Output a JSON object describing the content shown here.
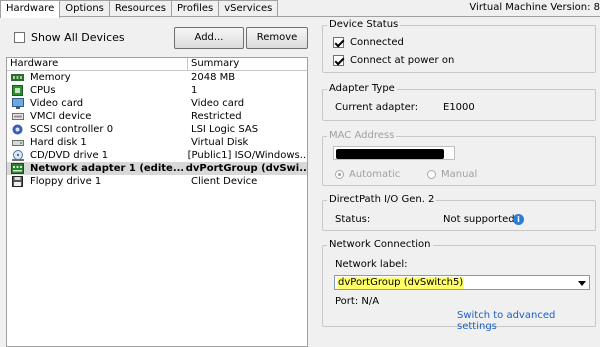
{
  "tabs": [
    {
      "label": "Hardware",
      "active": true
    },
    {
      "label": "Options",
      "active": false
    },
    {
      "label": "Resources",
      "active": false
    },
    {
      "label": "Profiles",
      "active": false
    },
    {
      "label": "vServices",
      "active": false
    }
  ],
  "vm_version": "Virtual Machine Version: 8",
  "toolbar": {
    "show_all_label": "Show All Devices",
    "show_all_checked": false,
    "add_label": "Add...",
    "remove_label": "Remove"
  },
  "table": {
    "headers": [
      "Hardware",
      "Summary"
    ],
    "rows": [
      {
        "icon": "memory-icon",
        "name": "Memory",
        "summary": "2048 MB"
      },
      {
        "icon": "cpu-icon",
        "name": "CPUs",
        "summary": "1"
      },
      {
        "icon": "monitor-icon",
        "name": "Video card",
        "summary": "Video card"
      },
      {
        "icon": "device-icon",
        "name": "VMCI device",
        "summary": "Restricted"
      },
      {
        "icon": "controller-icon",
        "name": "SCSI controller 0",
        "summary": "LSI Logic SAS"
      },
      {
        "icon": "disk-icon",
        "name": "Hard disk 1",
        "summary": "Virtual Disk"
      },
      {
        "icon": "cd-icon",
        "name": "CD/DVD drive 1",
        "summary": "[Public1] ISO/Windows..."
      },
      {
        "icon": "network-icon",
        "name": "Network adapter 1 (edite...",
        "summary": "dvPortGroup (dvSwi...",
        "selected": true
      },
      {
        "icon": "floppy-icon",
        "name": "Floppy drive 1",
        "summary": "Client Device"
      }
    ]
  },
  "device_status": {
    "title": "Device Status",
    "connected_label": "Connected",
    "connected_checked": true,
    "power_on_label": "Connect at power on",
    "power_on_checked": true
  },
  "adapter_type": {
    "title": "Adapter Type",
    "current_label": "Current adapter:",
    "current_value": "E1000"
  },
  "mac_address": {
    "title": "MAC Address",
    "automatic_label": "Automatic",
    "manual_label": "Manual"
  },
  "directpath": {
    "title": "DirectPath I/O Gen. 2",
    "status_label": "Status:",
    "status_value": "Not supported"
  },
  "network_connection": {
    "title": "Network Connection",
    "network_label": "Network label:",
    "selected_network": "dvPortGroup (dvSwitch5)",
    "port_text": "Port:  N/A",
    "advanced_link": "Switch to advanced settings"
  },
  "colors": {
    "highlight": "#ffff66",
    "link": "#1a5fc2",
    "info": "#2d7cd4"
  }
}
